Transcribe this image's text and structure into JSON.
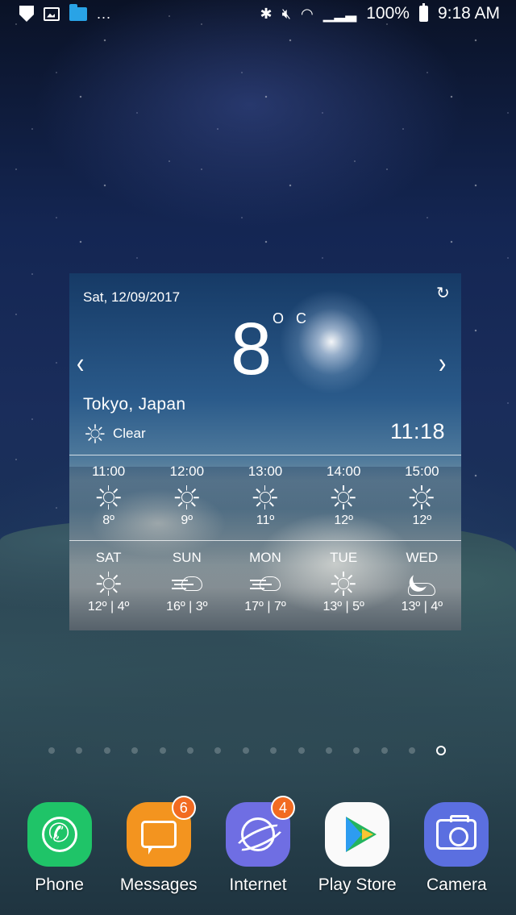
{
  "status_bar": {
    "notification_icons": [
      "shield-icon",
      "image-icon",
      "folder-icon"
    ],
    "overflow": "...",
    "system_icons": [
      "bluetooth-icon",
      "mute-icon",
      "wifi-icon",
      "signal-icon"
    ],
    "battery": "100%",
    "time": "9:18 AM"
  },
  "widget": {
    "date": "Sat, 12/09/2017",
    "temperature": "8",
    "unit": "O C",
    "location": "Tokyo, Japan",
    "condition": "Clear",
    "time": "11:18",
    "hourly": [
      {
        "time": "11:00",
        "icon": "sun-icon",
        "temp": "8º"
      },
      {
        "time": "12:00",
        "icon": "sun-icon",
        "temp": "9º"
      },
      {
        "time": "13:00",
        "icon": "sun-icon",
        "temp": "11º"
      },
      {
        "time": "14:00",
        "icon": "sun-icon",
        "temp": "12º"
      },
      {
        "time": "15:00",
        "icon": "sun-icon",
        "temp": "12º"
      }
    ],
    "daily": [
      {
        "day": "SAT",
        "icon": "sun-icon",
        "temps": "12º | 4º"
      },
      {
        "day": "SUN",
        "icon": "wind-cloud-icon",
        "temps": "16º | 3º"
      },
      {
        "day": "MON",
        "icon": "wind-cloud-icon",
        "temps": "17º | 7º"
      },
      {
        "day": "TUE",
        "icon": "sun-icon",
        "temps": "13º | 5º"
      },
      {
        "day": "WED",
        "icon": "moon-cloud-icon",
        "temps": "13º | 4º"
      }
    ]
  },
  "home_pages": {
    "count": 15,
    "active_index": 14
  },
  "dock": [
    {
      "name": "Phone",
      "icon": "phone-icon",
      "color": "#1fc468",
      "badge": ""
    },
    {
      "name": "Messages",
      "icon": "messages-icon",
      "color": "#f3941f",
      "badge": "6"
    },
    {
      "name": "Internet",
      "icon": "internet-icon",
      "color": "#6f6ee3",
      "badge": "4"
    },
    {
      "name": "Play Store",
      "icon": "play-store-icon",
      "color": "#fafafa",
      "badge": ""
    },
    {
      "name": "Camera",
      "icon": "camera-icon",
      "color": "#5b6fe0",
      "badge": ""
    }
  ]
}
